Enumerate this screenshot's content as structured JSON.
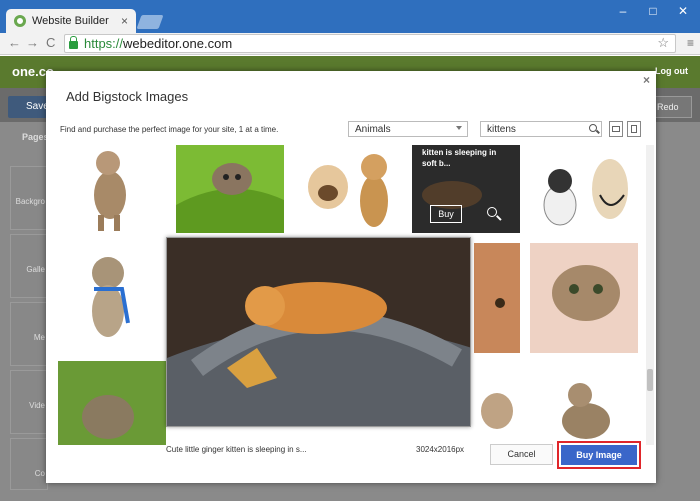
{
  "browser": {
    "tab_title": "Website Builder",
    "tab_close": "×",
    "url_scheme": "https://",
    "url_rest": "webeditor.one.com",
    "nav_back": "←",
    "nav_forward": "→",
    "nav_reload": "C",
    "star": "☆",
    "menu": "≡",
    "win_min": "–",
    "win_max": "□",
    "win_close": "✕"
  },
  "app": {
    "logo": "one.co",
    "logout": "Log out",
    "save": "Save",
    "redo": "Redo",
    "sidebar": {
      "pages": "Pages",
      "items": [
        "Backgro",
        "Galle",
        "Me",
        "Vide",
        "Co"
      ]
    }
  },
  "modal": {
    "title": "Add Bigstock Images",
    "close": "×",
    "subtitle": "Find and purchase the perfect image for your site, 1 at a time.",
    "category": "Animals",
    "search_value": "kittens",
    "hover_caption": "kitten is sleeping in soft b...",
    "hover_buy": "Buy",
    "preview_caption": "Cute little ginger kitten is sleeping in s...",
    "preview_size": "3024x2016px",
    "cancel": "Cancel",
    "buy_image": "Buy Image"
  },
  "colors": {
    "buy_button": "#3a66c9",
    "highlight": "#e0262a"
  }
}
